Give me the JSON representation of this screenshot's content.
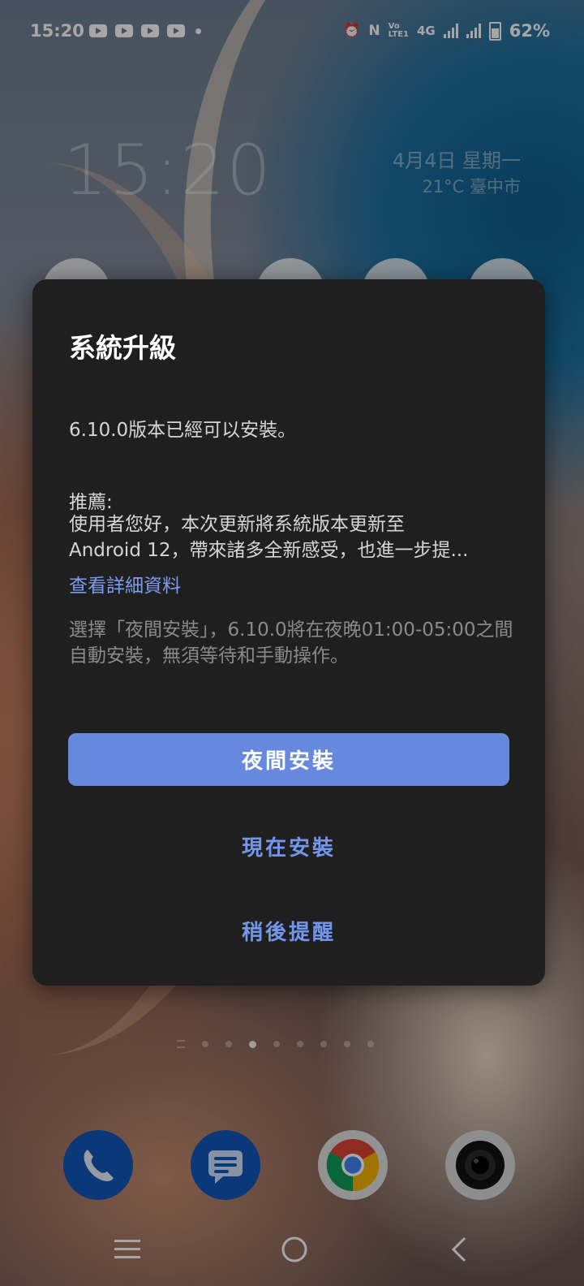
{
  "status_bar": {
    "time": "15:20",
    "battery": "62%",
    "network": "4G",
    "volte": "VoLTE1"
  },
  "home_widget": {
    "clock": "15:20",
    "date": "4月4日 星期一",
    "weather": "21°C 臺中市"
  },
  "dialog": {
    "title": "系統升級",
    "version_text": "6.10.0版本已經可以安裝。",
    "recommend_label": "推薦:",
    "recommend_line1": "使用者您好，本次更新將系統版本更新至",
    "recommend_line2": "Android 12，帶來諸多全新感受，也進一步提...",
    "details_link": "查看詳細資料",
    "note": "選擇「夜間安裝」，6.10.0將在夜晚01:00-05:00之間自動安裝，無須等待和手動操作。",
    "buttons": {
      "night_install": "夜間安裝",
      "install_now": "現在安裝",
      "remind_later": "稍後提醒"
    }
  },
  "colors": {
    "dialog_bg": "#1f1f1f",
    "accent": "#6789dd",
    "link": "#7397ec"
  },
  "dock": {
    "apps": [
      "phone-icon",
      "messages-icon",
      "chrome-icon",
      "camera-icon"
    ]
  }
}
